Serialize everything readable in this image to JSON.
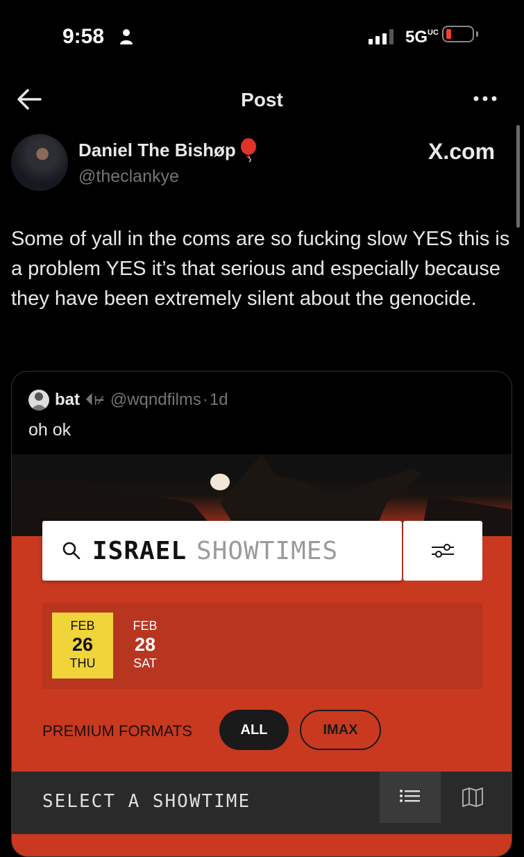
{
  "status_bar": {
    "time": "9:58",
    "network": "5G",
    "network_suffix": "UC"
  },
  "nav": {
    "title": "Post"
  },
  "post": {
    "author_name": "Daniel The Bishøp",
    "author_handle": "@theclankye",
    "watermark": "X.com",
    "text": "Some of yall in the coms are so fucking slow YES this is a problem YES it’s that serious and especially because they have been extremely silent about the genocide."
  },
  "quote": {
    "author_name": "bat",
    "author_glyphs": "⏴⊬",
    "author_handle": "@wqndfilms",
    "separator": "·",
    "time_ago": "1d",
    "text": "oh ok"
  },
  "media": {
    "search_term": "ISRAEL",
    "search_suffix": "SHOWTIMES",
    "dates": [
      {
        "month": "FEB",
        "day": "26",
        "weekday": "THU",
        "selected": true
      },
      {
        "month": "FEB",
        "day": "28",
        "weekday": "SAT",
        "selected": false
      }
    ],
    "formats_label": "PREMIUM FORMATS",
    "format_options": [
      "ALL",
      "IMAX"
    ],
    "showtime_label": "SELECT A SHOWTIME",
    "colors": {
      "poster_red": "#c9391f",
      "date_selected": "#f0d43a"
    }
  }
}
